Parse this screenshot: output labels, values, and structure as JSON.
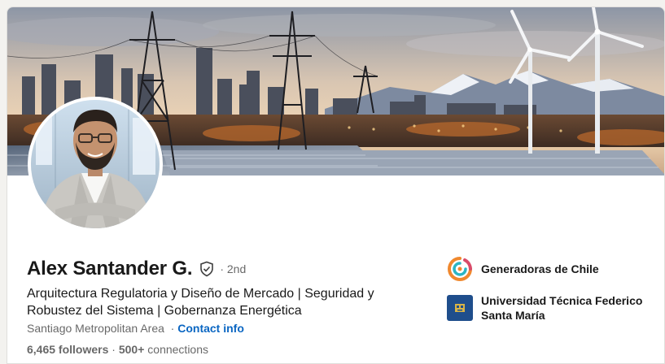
{
  "profile": {
    "name": "Alex Santander G.",
    "degree": "· 2nd",
    "headline": "Arquitectura Regulatoria y Diseño de Mercado | Seguridad y Robustez del Sistema | Gobernanza Energética",
    "location": "Santiago Metropolitan Area",
    "location_sep": "·",
    "contact_label": "Contact info",
    "followers": "6,465 followers",
    "stats_sep": "·",
    "connections_count": "500+",
    "connections_label": "connections"
  },
  "orgs": [
    {
      "name": "Generadoras de Chile",
      "icon": "generadoras-logo"
    },
    {
      "name": "Universidad Técnica Federico Santa María",
      "icon": "utfsm-logo"
    }
  ],
  "colors": {
    "link": "#0a66c2",
    "page_bg": "#f3f2ef",
    "card_bg": "#ffffff"
  }
}
